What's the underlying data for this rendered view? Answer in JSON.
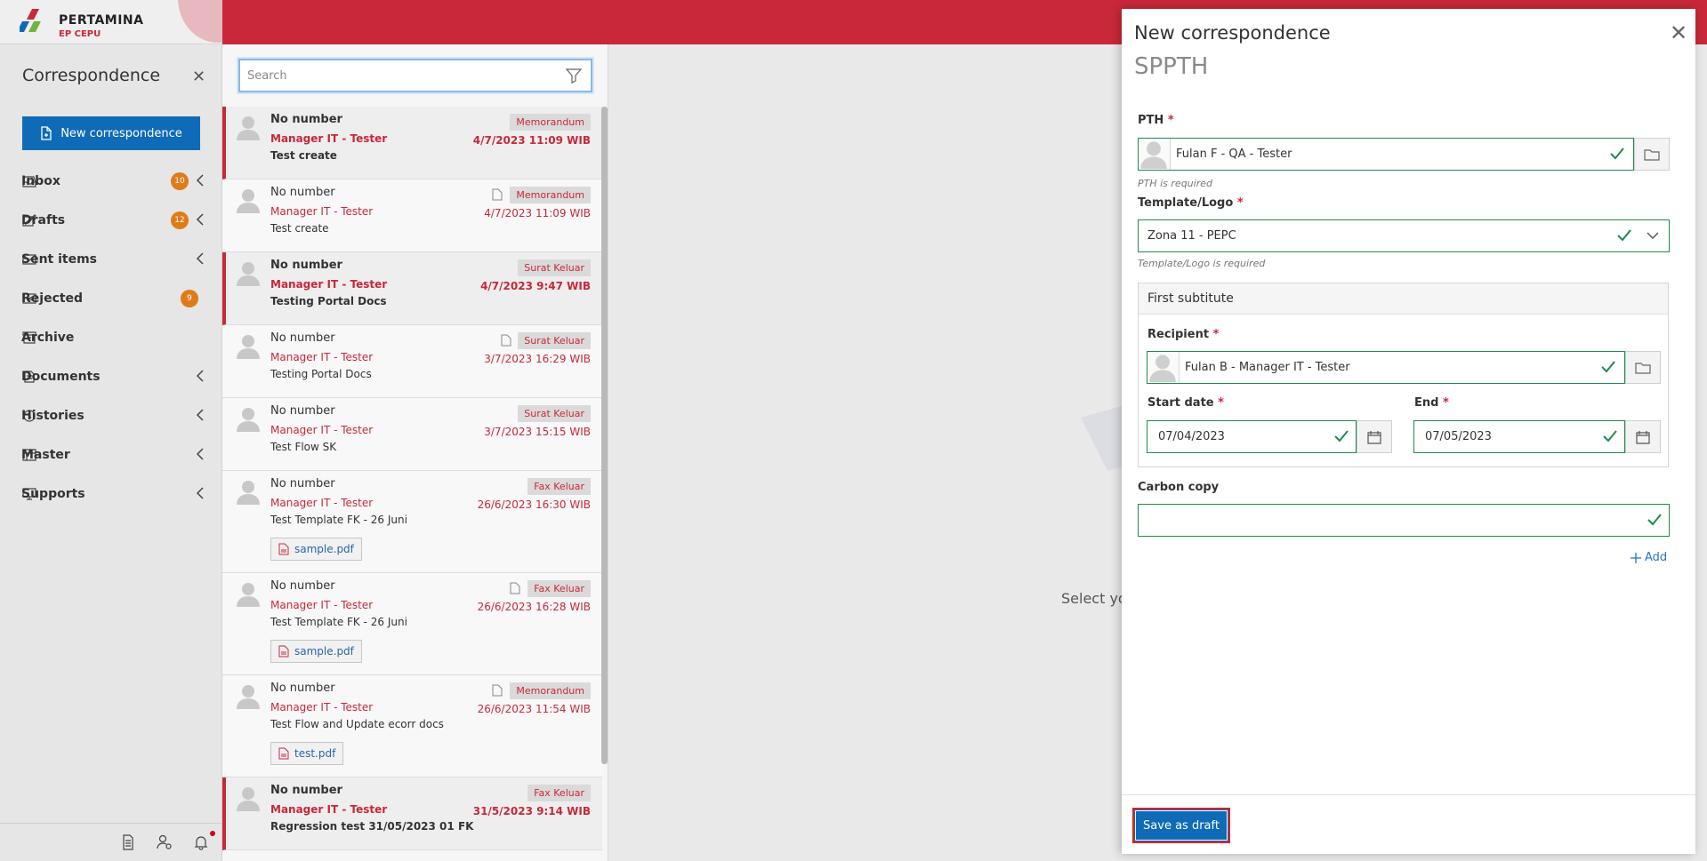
{
  "brand": {
    "name": "PERTAMINA",
    "sub": "EP CEPU",
    "colors": {
      "primary": "#c8283a",
      "accent": "#0f6bb8",
      "success": "#1f8a4c",
      "badge": "#e07b1a"
    }
  },
  "sidebar": {
    "title": "Correspondence",
    "new_button": "New correspondence",
    "items": [
      {
        "label": "Inbox",
        "icon": "inbox-icon",
        "badge": "10",
        "chevron": true
      },
      {
        "label": "Drafts",
        "icon": "drafts-icon",
        "badge": "12",
        "chevron": true
      },
      {
        "label": "Sent items",
        "icon": "sent-icon",
        "badge": "",
        "chevron": true
      },
      {
        "label": "Rejected",
        "icon": "rejected-icon",
        "badge": "9",
        "chevron": false
      },
      {
        "label": "Archive",
        "icon": "archive-icon",
        "badge": "",
        "chevron": false
      },
      {
        "label": "Documents",
        "icon": "documents-icon",
        "badge": "",
        "chevron": true
      },
      {
        "label": "Histories",
        "icon": "history-icon",
        "badge": "",
        "chevron": true
      },
      {
        "label": "Master",
        "icon": "master-icon",
        "badge": "",
        "chevron": true
      },
      {
        "label": "Supports",
        "icon": "supports-icon",
        "badge": "",
        "chevron": true
      }
    ]
  },
  "list": {
    "search_placeholder": "Search",
    "items": [
      {
        "number": "No number",
        "sender": "Manager IT - Tester",
        "subject": "Test create",
        "tag": "Memorandum",
        "date": "4/7/2023 11:09 WIB",
        "unread": true,
        "doc_icon": false,
        "attachment": ""
      },
      {
        "number": "No number",
        "sender": "Manager IT - Tester",
        "subject": "Test create",
        "tag": "Memorandum",
        "date": "4/7/2023 11:09 WIB",
        "unread": false,
        "doc_icon": true,
        "attachment": ""
      },
      {
        "number": "No number",
        "sender": "Manager IT - Tester",
        "subject": "Testing Portal Docs",
        "tag": "Surat Keluar",
        "date": "4/7/2023 9:47 WIB",
        "unread": true,
        "doc_icon": false,
        "attachment": ""
      },
      {
        "number": "No number",
        "sender": "Manager IT - Tester",
        "subject": "Testing Portal Docs",
        "tag": "Surat Keluar",
        "date": "3/7/2023 16:29 WIB",
        "unread": false,
        "doc_icon": true,
        "attachment": ""
      },
      {
        "number": "No number",
        "sender": "Manager IT - Tester",
        "subject": "Test Flow SK",
        "tag": "Surat Keluar",
        "date": "3/7/2023 15:15 WIB",
        "unread": false,
        "doc_icon": false,
        "attachment": ""
      },
      {
        "number": "No number",
        "sender": "Manager IT - Tester",
        "subject": "Test Template FK - 26 Juni",
        "tag": "Fax Keluar",
        "date": "26/6/2023 16:30 WIB",
        "unread": false,
        "doc_icon": false,
        "attachment": "sample.pdf"
      },
      {
        "number": "No number",
        "sender": "Manager IT - Tester",
        "subject": "Test Template FK - 26 Juni",
        "tag": "Fax Keluar",
        "date": "26/6/2023 16:28 WIB",
        "unread": false,
        "doc_icon": true,
        "attachment": "sample.pdf"
      },
      {
        "number": "No number",
        "sender": "Manager IT - Tester",
        "subject": "Test Flow and Update ecorr docs",
        "tag": "Memorandum",
        "date": "26/6/2023 11:54 WIB",
        "unread": false,
        "doc_icon": true,
        "attachment": "test.pdf"
      },
      {
        "number": "No number",
        "sender": "Manager IT - Tester",
        "subject": "Regression test 31/05/2023 01 FK",
        "tag": "Fax Keluar",
        "date": "31/5/2023 9:14 WIB",
        "unread": true,
        "doc_icon": false,
        "attachment": ""
      }
    ]
  },
  "center": {
    "hint": "Select yo"
  },
  "dialog": {
    "title": "New correspondence",
    "subtitle": "SPPTH",
    "pth": {
      "label": "PTH",
      "value": "Fulan F - QA - Tester",
      "hint": "PTH is required"
    },
    "template": {
      "label": "Template/Logo",
      "value": "Zona 11 - PEPC",
      "hint": "Template/Logo is required"
    },
    "first_substitute": {
      "heading": "First subtitute",
      "recipient_label": "Recipient",
      "recipient_value": "Fulan B - Manager IT - Tester",
      "start_label": "Start date",
      "start_value": "07/04/2023",
      "end_label": "End",
      "end_value": "07/05/2023"
    },
    "cc": {
      "label": "Carbon copy",
      "value": ""
    },
    "add_label": "Add",
    "save_label": "Save as draft"
  }
}
